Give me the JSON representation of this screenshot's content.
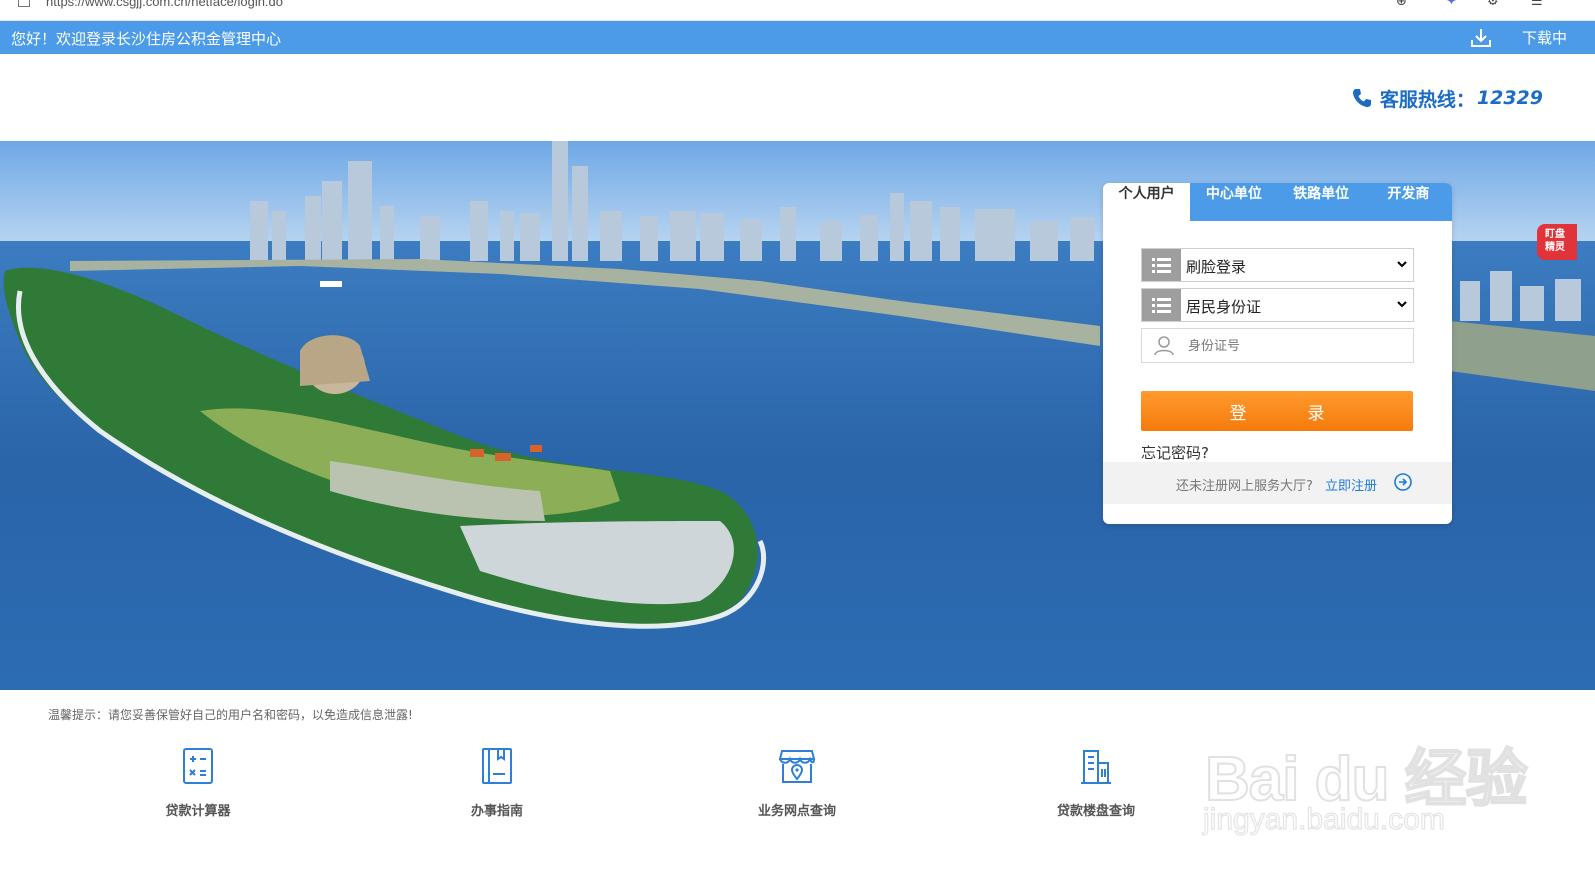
{
  "browser": {
    "url": "https://www.csgjj.com.cn/netface/login.do"
  },
  "topbar": {
    "welcome": "您好！欢迎登录长沙住房公积金管理中心",
    "download_label": "下载中"
  },
  "header": {
    "hotline_label": "客服热线：",
    "hotline_number": "12329"
  },
  "login": {
    "tabs": [
      {
        "label": "个人用户",
        "active": true
      },
      {
        "label": "中心单位",
        "active": false
      },
      {
        "label": "铁路单位",
        "active": false
      },
      {
        "label": "开发商",
        "active": false
      }
    ],
    "method_select": "刷脸登录",
    "id_type_select": "居民身份证",
    "id_placeholder": "身份证号",
    "login_button": "登　录",
    "forgot_password": "忘记密码?",
    "register_prompt": "还未注册网上服务大厅?",
    "register_link": "立即注册"
  },
  "side_tag": {
    "line1": "盯盘",
    "line2": "精灵"
  },
  "tip": "温馨提示：请您妥善保管好自己的用户名和密码，以免造成信息泄露!",
  "quick_links": [
    {
      "label": "贷款计算器",
      "icon": "calculator-icon"
    },
    {
      "label": "办事指南",
      "icon": "guide-book-icon"
    },
    {
      "label": "业务网点查询",
      "icon": "service-outlet-icon"
    },
    {
      "label": "贷款楼盘查询",
      "icon": "building-icon"
    }
  ],
  "watermark": {
    "brand": "Bai du 经验",
    "domain": "jingyan.baidu.com"
  },
  "colors": {
    "brand_blue": "#4b9be8",
    "button_orange": "#f7850f",
    "link_blue": "#1f7bd8",
    "hotline_blue": "#1d6cc4"
  }
}
